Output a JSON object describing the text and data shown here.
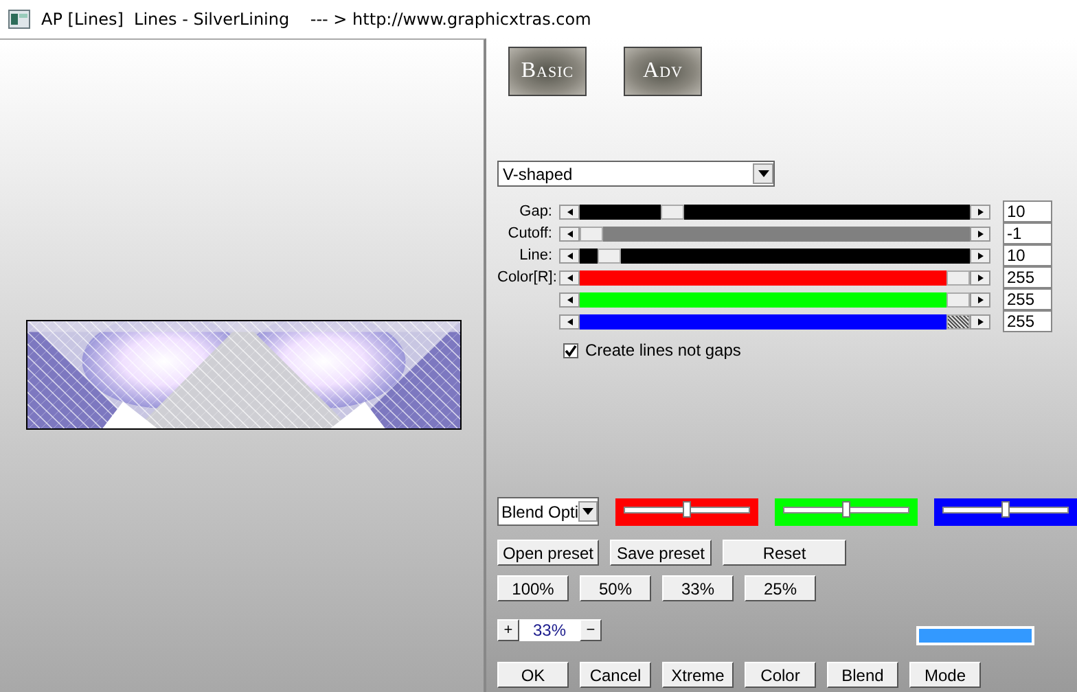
{
  "window": {
    "title": "AP [Lines]  Lines - SilverLining    --- > http://www.graphicxtras.com"
  },
  "preview": {
    "kind": "picture"
  },
  "mode_buttons": [
    "Basic",
    "Adv"
  ],
  "style_dropdown": {
    "value": "V-shaped"
  },
  "sliders": [
    {
      "label": "Gap:",
      "color": "#000000",
      "level": 0.22,
      "value": "10",
      "focused": false
    },
    {
      "label": "Cutoff:",
      "color": "#808080",
      "level": 0,
      "value": "-1",
      "focused": false
    },
    {
      "label": "Line:",
      "color": "#000000",
      "level": 0.05,
      "value": "10",
      "focused": false
    },
    {
      "label": "Color[R]:",
      "color": "#ff0000",
      "level": 1,
      "value": "255",
      "focused": false
    },
    {
      "color": "#00ff00",
      "level": 1,
      "value": "255",
      "focused": false
    },
    {
      "color": "#0000ff",
      "level": 1,
      "value": "255",
      "focused": true
    }
  ],
  "create_lines": {
    "label": "Create lines not gaps",
    "checked": true
  },
  "blend_dropdown": {
    "value": "Blend Opti"
  },
  "blend_sliders": [
    {
      "color": "#ff0000",
      "level": 0.5
    },
    {
      "color": "#00ff00",
      "level": 0.5
    },
    {
      "color": "#0000ff",
      "level": 0.5
    }
  ],
  "preset_buttons": [
    "Open preset",
    "Save preset",
    "Reset"
  ],
  "zoom_buttons": [
    "100%",
    "50%",
    "33%",
    "25%"
  ],
  "zoom": {
    "plus": "+",
    "value": "33%",
    "minus": "−"
  },
  "swatch": {
    "color": "#3399ff"
  },
  "bottom_buttons": [
    "OK",
    "Cancel",
    "Xtreme",
    "Color",
    "Blend",
    "Mode"
  ]
}
